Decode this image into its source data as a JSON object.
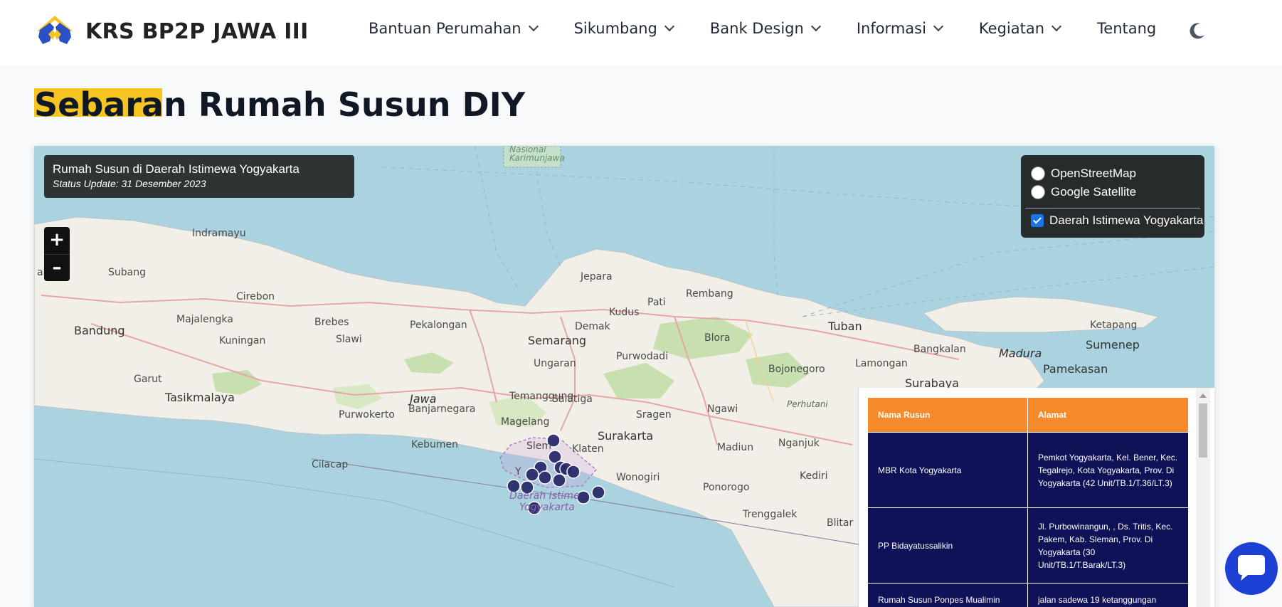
{
  "header": {
    "brand": "KRS BP2P JAWA III",
    "nav": [
      {
        "label": "Bantuan Perumahan",
        "has_dropdown": true
      },
      {
        "label": "Sikumbang",
        "has_dropdown": true
      },
      {
        "label": "Bank Design",
        "has_dropdown": true
      },
      {
        "label": "Informasi",
        "has_dropdown": true
      },
      {
        "label": "Kegiatan",
        "has_dropdown": true
      },
      {
        "label": "Tentang",
        "has_dropdown": false
      }
    ],
    "theme_icon": "moon-icon"
  },
  "page": {
    "title": "Sebaran Rumah Susun DIY",
    "highlight_color": "#f6c522"
  },
  "map": {
    "info_title": "Rumah Susun di Daerah Istimewa Yogyakarta",
    "info_subtitle": "Status Update: 31 Desember 2023",
    "zoom_in": "+",
    "zoom_out": "–",
    "base_layers": [
      "OpenStreetMap",
      "Google Satellite"
    ],
    "overlay_layer": "Daerah Istimewa Yogyakarta",
    "overlay_checked": true,
    "marker_color": "#2a2c6b",
    "places": {
      "nasional": "Nasional",
      "karimunjawa": "Karimunjawa",
      "indramayu": "Indramayu",
      "karta": "akarta",
      "subang": "Subang",
      "jepara": "Jepara",
      "rembang": "Rembang",
      "cirebon": "Cirebon",
      "kudus": "Kudus",
      "pati": "Pati",
      "majalengka": "Majalengka",
      "brebes": "Brebes",
      "pekalongan": "Pekalongan",
      "demak": "Demak",
      "tuban": "Tuban",
      "ketapang": "Ketapang",
      "bandung": "Bandung",
      "kuningan": "Kuningan",
      "slawi": "Slawi",
      "semarang": "Semarang",
      "blora": "Blora",
      "bangkalan": "Bangkalan",
      "madura": "Madura",
      "sumenep": "Sumenep",
      "ungaran": "Ungaran",
      "purwodadi": "Purwodadi",
      "bojonegoro": "Bojonegoro",
      "lamongan": "Lamongan",
      "pamekasan": "Pamekasan",
      "garut": "Garut",
      "surabaya": "Surabaya",
      "tasikmalaya": "Tasikmalaya",
      "jawa": "Jawa",
      "banjarnegara": "Banjarnegara",
      "temanggung": "Temanggung",
      "salatiga": "Salatiga",
      "purwokerto": "Purwokerto",
      "sragen": "Sragen",
      "ngawi": "Ngawi",
      "perhutani": "Perhutani",
      "magelang": "Magelang",
      "surakarta": "Surakarta",
      "kebumen": "Kebumen",
      "sleman": "Slem",
      "klaten": "Klaten",
      "madiun": "Madiun",
      "nganjuk": "Nganjuk",
      "cilacap": "Cilacap",
      "wonogiri": "Wonogiri",
      "kediri": "Kediri",
      "yogyakarta_y": "Y",
      "daerah_istimewa": "Daerah Istime",
      "yogyakarta": "Yogyakarta",
      "ponorogo": "Ponorogo",
      "trenggalek": "Trenggalek",
      "blitar": "Blitar"
    }
  },
  "table": {
    "headers": [
      "Nama Rusun",
      "Alamat"
    ],
    "rows": [
      {
        "nama": "MBR Kota Yogyakarta",
        "alamat": "Pemkot Yogyakarta, Kel. Bener, Kec. Tegalrejo, Kota Yogyakarta, Prov. Di Yogyakarta (42 Unit/TB.1/T.36/LT.3)"
      },
      {
        "nama": "PP Bidayatussalikin",
        "alamat": "Jl. Purbowinangun, , Ds. Tritis, Kec. Pakem, Kab. Sleman, Prov. Di Yogyakarta (30 Unit/TB.1/T.Barak/LT.3)"
      },
      {
        "nama": "Rumah Susun Ponpes Mualimin",
        "alamat": "jalan sadewa 19 ketanggungan"
      }
    ]
  },
  "chat": {
    "icon": "chat-icon",
    "color": "#1c3fd4"
  }
}
